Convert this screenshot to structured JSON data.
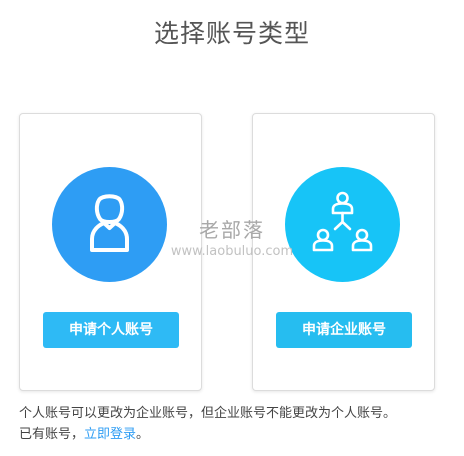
{
  "page": {
    "title": "选择账号类型"
  },
  "cards": {
    "personal": {
      "icon": "person-icon",
      "button_label": "申请个人账号"
    },
    "enterprise": {
      "icon": "organization-icon",
      "button_label": "申请企业账号"
    }
  },
  "watermark": {
    "text_cn": "老部落",
    "url": "www.laobuluo.com"
  },
  "footer": {
    "note": "个人账号可以更改为企业账号，但企业账号不能更改为个人账号。",
    "login_prefix": "已有账号，",
    "login_link": "立即登录",
    "login_suffix": "。"
  },
  "colors": {
    "personal_circle": "#2e9df4",
    "enterprise_circle": "#17c4f7",
    "button": "#2ebaf5",
    "link": "#2e9df4"
  }
}
